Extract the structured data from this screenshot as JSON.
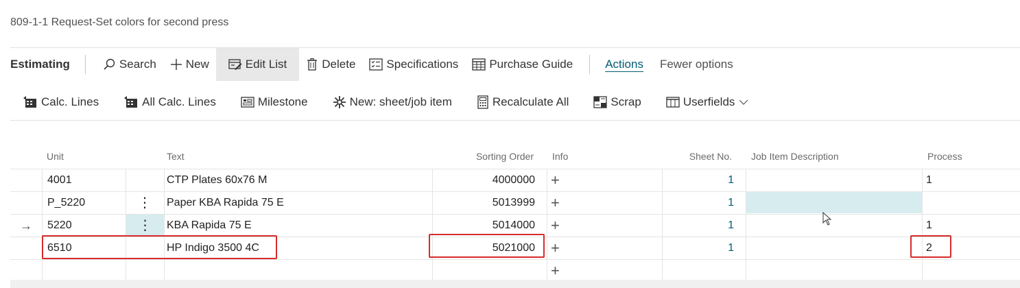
{
  "title": "809-1-1 Request-Set colors for second press",
  "toolbar1": {
    "section": "Estimating",
    "search": "Search",
    "new": "New",
    "edit_list": "Edit List",
    "delete": "Delete",
    "specifications": "Specifications",
    "purchase_guide": "Purchase Guide",
    "actions": "Actions",
    "fewer_options": "Fewer options"
  },
  "toolbar2": {
    "calc_lines": "Calc. Lines",
    "all_calc_lines": "All Calc. Lines",
    "milestone": "Milestone",
    "new_sheet_job_item": "New: sheet/job item",
    "recalculate_all": "Recalculate All",
    "scrap": "Scrap",
    "userfields": "Userfields"
  },
  "columns": {
    "unit": "Unit",
    "text": "Text",
    "sorting_order": "Sorting Order",
    "info": "Info",
    "sheet_no": "Sheet No.",
    "job_item_description": "Job Item Description",
    "process": "Process"
  },
  "rows": [
    {
      "unit": "4001",
      "text": "CTP Plates 60x76 M",
      "sorting_order": "4000000",
      "info": "+",
      "sheet_no": "1",
      "job_item_description": "",
      "process": "1"
    },
    {
      "unit": "P_5220",
      "text": "Paper KBA Rapida 75 E",
      "sorting_order": "5013999",
      "info": "+",
      "sheet_no": "1",
      "job_item_description": "",
      "process": ""
    },
    {
      "unit": "5220",
      "text": "KBA Rapida 75 E",
      "sorting_order": "5014000",
      "info": "+",
      "sheet_no": "1",
      "job_item_description": "",
      "process": "1"
    },
    {
      "unit": "6510",
      "text": "HP Indigo 3500 4C",
      "sorting_order": "5021000",
      "info": "+",
      "sheet_no": "1",
      "job_item_description": "",
      "process": "2"
    },
    {
      "unit": "",
      "text": "",
      "sorting_order": "",
      "info": "+",
      "sheet_no": "",
      "job_item_description": "",
      "process": ""
    }
  ],
  "row_menu_glyph": "⋮",
  "current_row_glyph": "→",
  "colors": {
    "accent": "#005c73",
    "highlight": "#d7ecef",
    "annotation": "#d62b2b"
  }
}
